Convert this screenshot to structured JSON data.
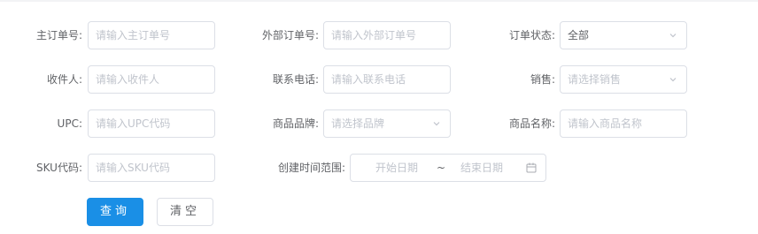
{
  "form": {
    "main_order_no": {
      "label": "主订单号:",
      "placeholder": "请输入主订单号"
    },
    "external_order_no": {
      "label": "外部订单号:",
      "placeholder": "请输入外部订单号"
    },
    "order_status": {
      "label": "订单状态:",
      "value": "全部"
    },
    "receiver": {
      "label": "收件人:",
      "placeholder": "请输入收件人"
    },
    "phone": {
      "label": "联系电话:",
      "placeholder": "请输入联系电话"
    },
    "sales": {
      "label": "销售:",
      "placeholder": "请选择销售"
    },
    "upc": {
      "label": "UPC:",
      "placeholder": "请输入UPC代码"
    },
    "brand": {
      "label": "商品品牌:",
      "placeholder": "请选择品牌"
    },
    "product_name": {
      "label": "商品名称:",
      "placeholder": "请输入商品名称"
    },
    "sku": {
      "label": "SKU代码:",
      "placeholder": "请输入SKU代码"
    },
    "created_range": {
      "label": "创建时间范围:",
      "start_placeholder": "开始日期",
      "separator": "~",
      "end_placeholder": "结束日期"
    }
  },
  "actions": {
    "query_label": "查询",
    "clear_label": "清空"
  },
  "colors": {
    "primary": "#1a8fe6",
    "border": "#dcdfe6",
    "placeholder": "#c0c4cc",
    "text": "#606266"
  }
}
